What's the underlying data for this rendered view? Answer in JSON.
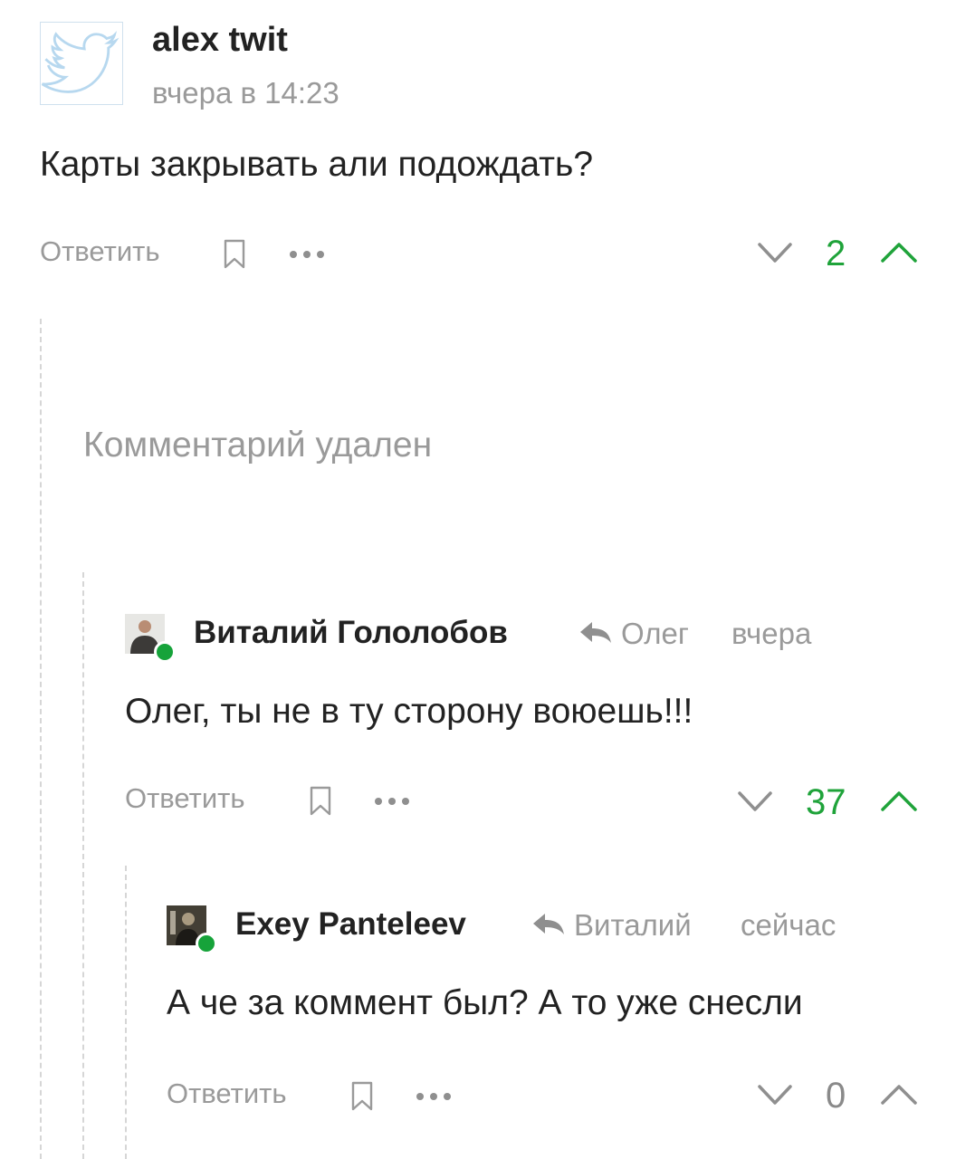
{
  "comments": [
    {
      "username": "alex twit",
      "time": "вчера в 14:23",
      "text": "Карты закрывать али подождать?",
      "reply_label": "Ответить",
      "score": "2",
      "avatar_icon": "twitter-bird-icon"
    },
    {
      "deleted_text": "Комментарий удален"
    },
    {
      "username": "Виталий Гололобов",
      "reply_to": "Олег",
      "time": "вчера",
      "text": "Олег, ты не в ту сторону воюешь!!!",
      "reply_label": "Ответить",
      "score": "37"
    },
    {
      "username": "Exey Panteleev",
      "reply_to": "Виталий",
      "time": "сейчас",
      "text": "А че за коммент был? А то уже снесли",
      "reply_label": "Ответить",
      "score": "0"
    }
  ],
  "colors": {
    "accent_green": "#1fa33a",
    "online_green": "#16a33a",
    "meta_gray": "#9a9a9a",
    "guide_gray": "#d6d6d6"
  },
  "icons": {
    "bookmark": "bookmark-icon",
    "more": "more-dots-icon",
    "downvote": "chevron-down-icon",
    "upvote": "chevron-up-icon",
    "reply_arrow": "reply-arrow-icon"
  }
}
